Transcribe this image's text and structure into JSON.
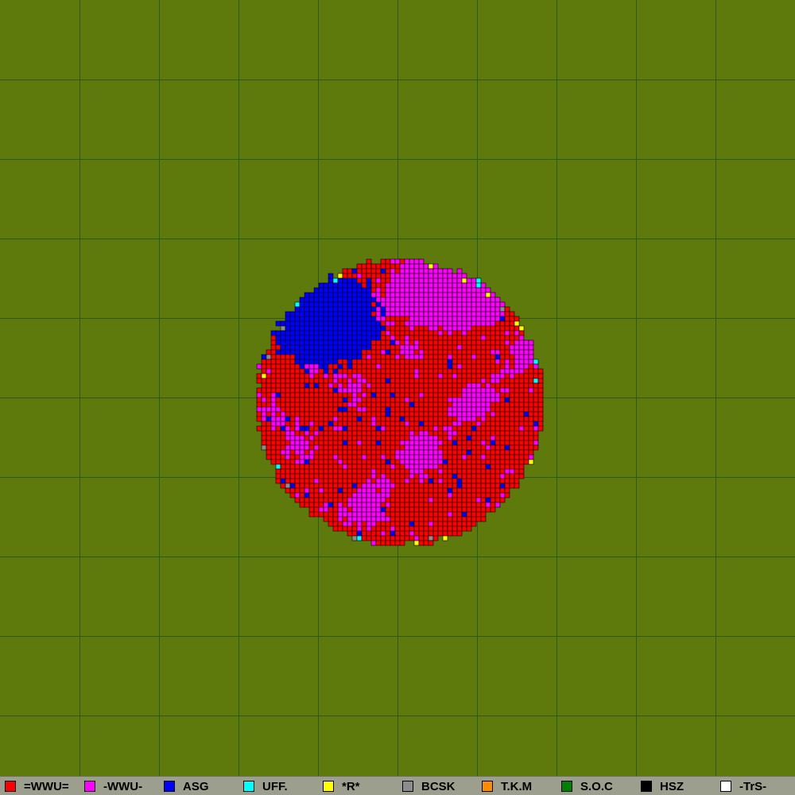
{
  "map": {
    "background_color": "#5f7a0c",
    "grid_color": "#2f5a0a",
    "grid_divisions": 10,
    "outline_color": "#000000"
  },
  "legend": {
    "items": [
      {
        "label": "=WWU=",
        "color": "#ff0000"
      },
      {
        "label": "-WWU-",
        "color": "#ff00ff"
      },
      {
        "label": "ASG",
        "color": "#0000ff"
      },
      {
        "label": "UFF.",
        "color": "#00ffff"
      },
      {
        "label": "*R*",
        "color": "#ffff00"
      },
      {
        "label": "BCSK",
        "color": "#8c8c8c"
      },
      {
        "label": "T.K.M",
        "color": "#ff8c00"
      },
      {
        "label": "S.O.C",
        "color": "#008000"
      },
      {
        "label": "HSZ",
        "color": "#000000"
      },
      {
        "label": "-TrS-",
        "color": "#ffffff"
      }
    ]
  }
}
